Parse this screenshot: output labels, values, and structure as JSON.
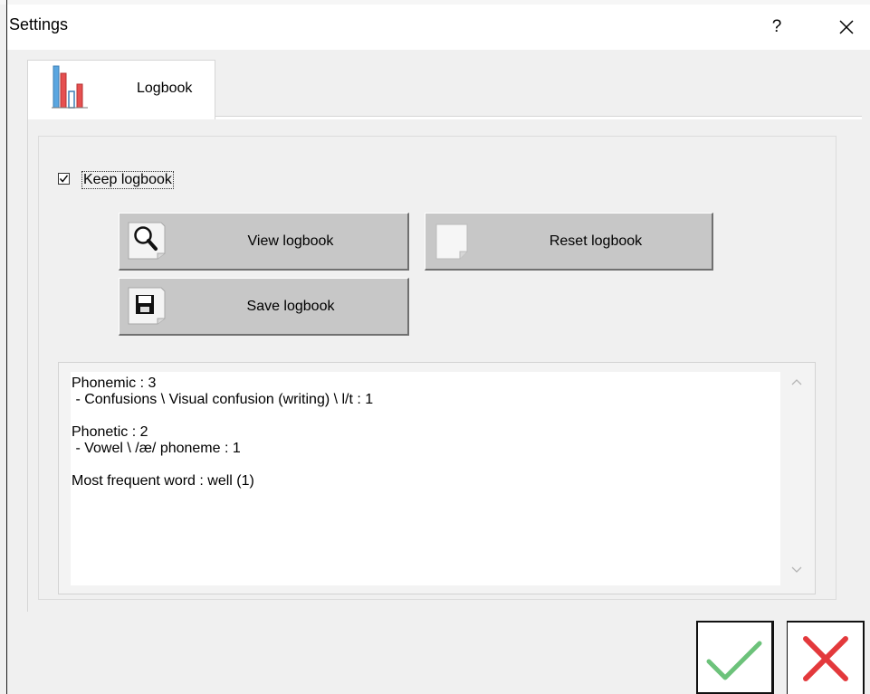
{
  "window": {
    "title": "Settings",
    "help_label": "?",
    "close_icon": "close-icon"
  },
  "tabs": [
    {
      "label": "Logbook",
      "icon": "bar-chart-icon",
      "selected": true
    }
  ],
  "logbook": {
    "keep_logbook": {
      "label": "Keep logbook",
      "checked": true
    },
    "buttons": {
      "view": {
        "label": "View logbook",
        "icon": "magnifier-icon"
      },
      "reset": {
        "label": "Reset logbook",
        "icon": "blank-page-icon"
      },
      "save": {
        "label": "Save logbook",
        "icon": "floppy-disk-icon"
      }
    },
    "log_lines": [
      "Phonemic : 3",
      " - Confusions \\ Visual confusion (writing) \\ l/t : 1",
      "",
      "Phonetic : 2",
      " - Vowel \\ /æ/ phoneme : 1",
      "",
      "Most frequent word : well (1)"
    ]
  },
  "footer": {
    "ok_icon": "check-icon",
    "cancel_icon": "x-icon"
  },
  "colors": {
    "ok_green": "#6cc27a",
    "cancel_red": "#e3393c",
    "chart_blue": "#5aa6e0",
    "chart_red": "#e65050"
  }
}
